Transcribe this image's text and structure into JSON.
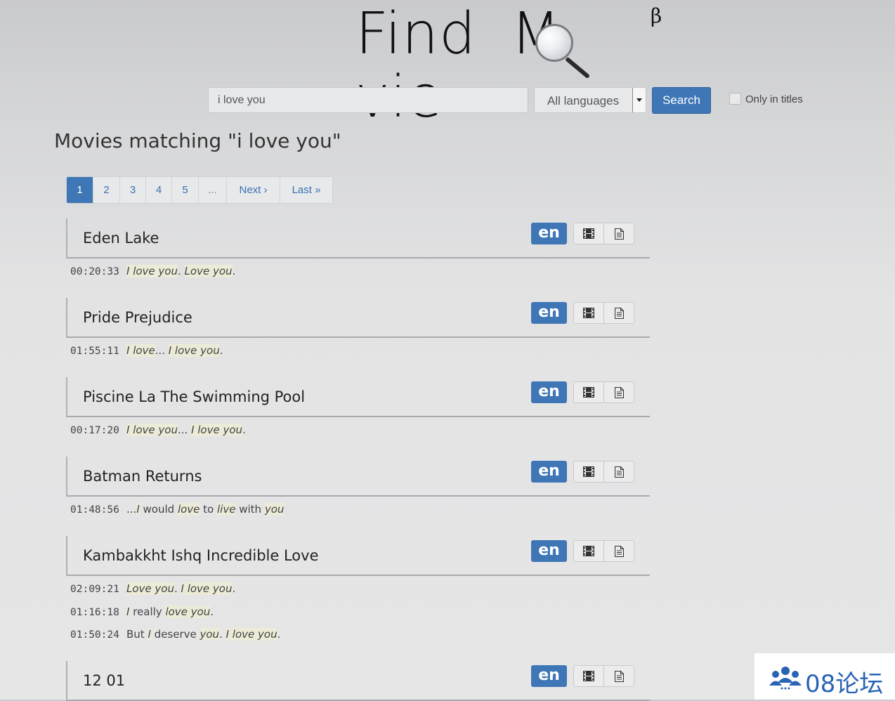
{
  "logo": {
    "part1": "Find",
    "part2": "M",
    "part3": "vie",
    "beta": "β"
  },
  "search": {
    "query_value": "i love you",
    "language_selected": "All languages",
    "button_label": "Search",
    "only_titles_label": "Only in titles",
    "only_titles_checked": false
  },
  "page_title": "Movies matching \"i love you\"",
  "pagination": {
    "items": [
      {
        "label": "1",
        "active": true
      },
      {
        "label": "2",
        "active": false
      },
      {
        "label": "3",
        "active": false
      },
      {
        "label": "4",
        "active": false
      },
      {
        "label": "5",
        "active": false
      },
      {
        "label": "...",
        "active": false
      },
      {
        "label": "Next ›",
        "active": false
      },
      {
        "label": "Last »",
        "active": false
      }
    ]
  },
  "results": [
    {
      "title": "Eden Lake",
      "lang": "en",
      "lines": [
        {
          "time": "00:20:33",
          "text": [
            {
              "t": "I love you",
              "h": true
            },
            {
              "t": ". ",
              "h": false
            },
            {
              "t": "Love you",
              "h": true
            },
            {
              "t": ".",
              "h": false
            }
          ]
        }
      ]
    },
    {
      "title": "Pride Prejudice",
      "lang": "en",
      "lines": [
        {
          "time": "01:55:11",
          "text": [
            {
              "t": "I love",
              "h": true
            },
            {
              "t": "... ",
              "h": false
            },
            {
              "t": "I love you",
              "h": true
            },
            {
              "t": ".",
              "h": false
            }
          ]
        }
      ]
    },
    {
      "title": "Piscine La The Swimming Pool",
      "lang": "en",
      "lines": [
        {
          "time": "00:17:20",
          "text": [
            {
              "t": "I love you",
              "h": true
            },
            {
              "t": "... ",
              "h": false
            },
            {
              "t": "I love you",
              "h": true
            },
            {
              "t": ".",
              "h": false
            }
          ]
        }
      ]
    },
    {
      "title": "Batman Returns",
      "lang": "en",
      "lines": [
        {
          "time": "01:48:56",
          "text": [
            {
              "t": "...",
              "h": false
            },
            {
              "t": "I",
              "h": true
            },
            {
              "t": " would ",
              "h": false
            },
            {
              "t": "love",
              "h": true
            },
            {
              "t": " to ",
              "h": false
            },
            {
              "t": "live",
              "h": true
            },
            {
              "t": " with ",
              "h": false
            },
            {
              "t": "you",
              "h": true
            }
          ]
        }
      ]
    },
    {
      "title": "Kambakkht Ishq Incredible Love",
      "lang": "en",
      "lines": [
        {
          "time": "02:09:21",
          "text": [
            {
              "t": "Love you",
              "h": true
            },
            {
              "t": ". ",
              "h": false
            },
            {
              "t": "I love you",
              "h": true
            },
            {
              "t": ".",
              "h": false
            }
          ]
        },
        {
          "time": "01:16:18",
          "text": [
            {
              "t": "I",
              "h": true
            },
            {
              "t": " really ",
              "h": false
            },
            {
              "t": "love you",
              "h": true
            },
            {
              "t": ".",
              "h": false
            }
          ]
        },
        {
          "time": "01:50:24",
          "text": [
            {
              "t": "But ",
              "h": false
            },
            {
              "t": "I",
              "h": true
            },
            {
              "t": " deserve ",
              "h": false
            },
            {
              "t": "you",
              "h": true
            },
            {
              "t": ". ",
              "h": false
            },
            {
              "t": "I love you",
              "h": true
            },
            {
              "t": ".",
              "h": false
            }
          ]
        }
      ]
    },
    {
      "title": "12 01",
      "lang": "en",
      "lines": []
    }
  ],
  "icons": {
    "video": "film-icon",
    "subtitle": "document-icon"
  },
  "colors": {
    "primary": "#3e76b6",
    "highlight": "#ecebd7",
    "watermark": "#2864b4"
  },
  "watermark": {
    "text": "08论坛"
  }
}
